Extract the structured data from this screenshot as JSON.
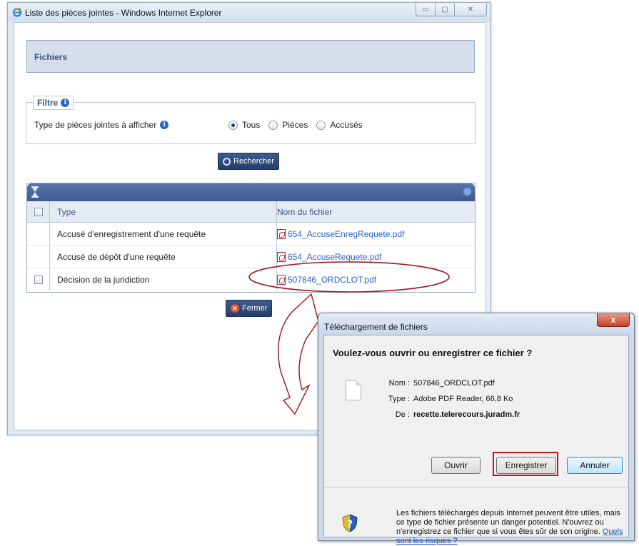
{
  "browser": {
    "title": "Liste des pièces jointes - Windows Internet Explorer",
    "controls": {
      "minimize": "▭",
      "maximize": "▢",
      "close": "✕"
    }
  },
  "page": {
    "section_title": "Fichiers",
    "filter": {
      "legend": "Filtre",
      "label": "Type de pièces jointes à afficher",
      "options": [
        "Tous",
        "Pièces",
        "Accusés"
      ],
      "selected": "Tous"
    },
    "search_button": "Rechercher",
    "table": {
      "columns": [
        "Type",
        "Nom du fichier"
      ],
      "rows": [
        {
          "type": "Accusé d'enregistrement d'une requête",
          "file": "654_AccuseEnregRequete.pdf",
          "checkbox": false
        },
        {
          "type": "Accusé de dépôt d'une requête",
          "file": "654_AccuseRequete.pdf",
          "checkbox": false
        },
        {
          "type": "Décision de la juridiction",
          "file": "507846_ORDCLOT.pdf",
          "checkbox": true
        }
      ]
    },
    "close_button": "Fermer"
  },
  "dialog": {
    "title": "Téléchargement de fichiers",
    "close": "x",
    "question": "Voulez-vous ouvrir ou enregistrer ce fichier ?",
    "fields": {
      "name_label": "Nom :",
      "name_value": "507846_ORDCLOT.pdf",
      "type_label": "Type :",
      "type_value": "Adobe PDF Reader, 66,8 Ko",
      "from_label": "De :",
      "from_value": "recette.telerecours.juradm.fr"
    },
    "buttons": {
      "open": "Ouvrir",
      "save": "Enregistrer",
      "cancel": "Annuler"
    },
    "warning": "Les fichiers téléchargés depuis Internet peuvent être utiles, mais ce type de fichier présente un danger potentiel. N'ouvrez ou n'enregistrez ce fichier que si vous êtes sûr de son origine.",
    "warning_link": "Quels sont les risques ?"
  },
  "colors": {
    "highlight": "#c2161b",
    "header_navy": "#3f5a8f",
    "link": "#2a62c9"
  }
}
